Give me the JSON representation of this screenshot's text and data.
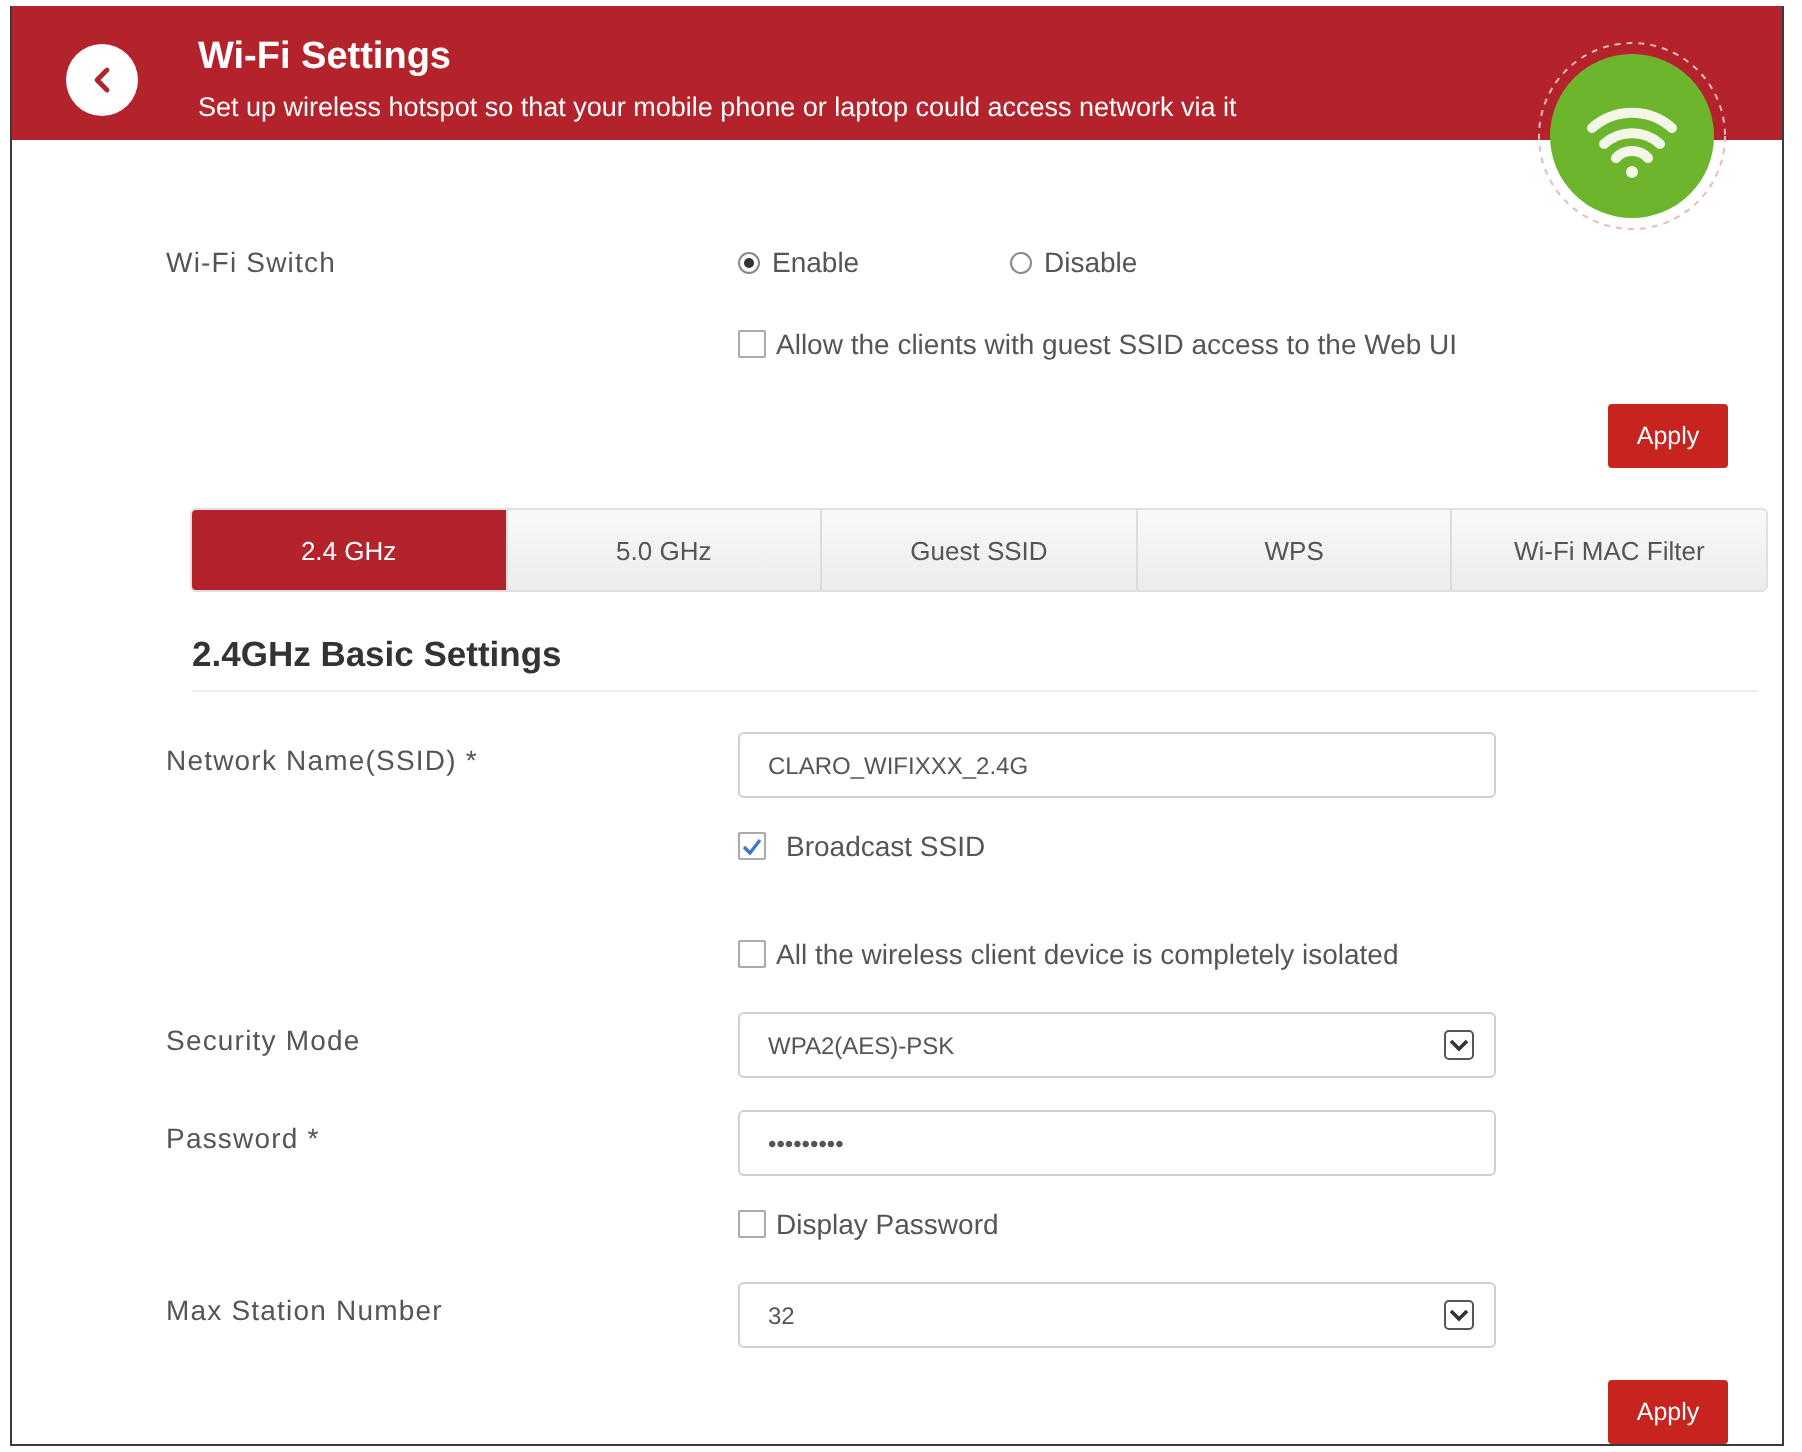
{
  "header": {
    "title": "Wi-Fi Settings",
    "subtitle": "Set up wireless hotspot so that your mobile phone or laptop could access network via it"
  },
  "switch_section": {
    "wifi_switch": {
      "label": "Wi-Fi Switch",
      "options": [
        {
          "label": "Enable",
          "selected": true
        },
        {
          "label": "Disable",
          "selected": false
        }
      ]
    },
    "guest_access": {
      "label": "Allow the clients with guest SSID access to the Web UI",
      "checked": false
    },
    "apply_button": "Apply"
  },
  "tabs": [
    {
      "label": "2.4 GHz",
      "selected": true
    },
    {
      "label": "5.0 GHz",
      "selected": false
    },
    {
      "label": "Guest SSID",
      "selected": false
    },
    {
      "label": "WPS",
      "selected": false
    },
    {
      "label": "Wi-Fi MAC Filter",
      "selected": false
    }
  ],
  "basic_settings": {
    "title": "2.4GHz Basic Settings",
    "fields": [
      {
        "kind": "text",
        "label": "Network Name(SSID) *",
        "value": "CLARO_WIFIXXX_2.4G"
      },
      {
        "kind": "checkbox",
        "label": "Broadcast SSID",
        "checked": true
      },
      {
        "kind": "checkbox",
        "label": "All the wireless client device is completely isolated",
        "checked": false
      },
      {
        "kind": "select",
        "label": "Security Mode",
        "value": "WPA2(AES)-PSK"
      },
      {
        "kind": "text",
        "label": "Password *",
        "value": "•••••••••"
      },
      {
        "kind": "checkbox",
        "label": "Display Password",
        "checked": false
      },
      {
        "kind": "select",
        "label": "Max Station Number",
        "value": "32"
      }
    ],
    "apply_button": "Apply"
  }
}
